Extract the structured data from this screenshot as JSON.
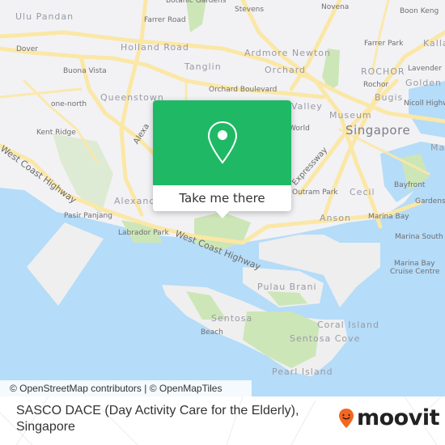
{
  "map": {
    "labels": {
      "ulu_pandan": "Ulu Pandan",
      "botanic_gardens": "Botanic Gardens",
      "farrer_road": "Farrer Road",
      "stevens": "Stevens",
      "novena": "Novena",
      "boon_keng": "Boon Keng",
      "dover": "Dover",
      "holland_road": "Holland Road",
      "ardmore": "Ardmore",
      "newton": "Newton",
      "farrer_park": "Farrer Park",
      "kallang": "Kalla",
      "tanglin": "Tanglin",
      "orchard": "Orchard",
      "rochor_area": "ROCHOR",
      "lavender": "Lavender",
      "buona_vista": "Buona Vista",
      "orchard_boulevard": "Orchard Boulevard",
      "rochor": "Rochor",
      "golden_mile": "Golden M",
      "queenstown": "Queenstown",
      "bugis": "Bugis",
      "valley": "Valley",
      "nicoll_highway": "Nicoll Highw",
      "one_north": "one-north",
      "museum": "Museum",
      "world": "World",
      "kent_ridge": "Kent Ridge",
      "singapore": "Singapore",
      "marina_area": "Mar",
      "alexandra_road": "Alexa",
      "expressway": "Expressway",
      "west_coast_highway_1": "West Coast Highway",
      "bayfront": "Bayfront",
      "alexandra": "Alexandr",
      "outram_park": "Outram Park",
      "cecil": "Cecil",
      "gardens": "Gardens",
      "pasir_panjang": "Pasir Panjang",
      "anson": "Anson",
      "marina_bay": "Marina Bay",
      "labrador_park": "Labrador Park",
      "west_coast_highway_2": "West Coast Highway",
      "marina_south_pier": "Marina South Pi",
      "marina_bay_cruise_1": "Marina Bay",
      "marina_bay_cruise_2": "Cruise Centre",
      "pulau_brani": "Pulau Brani",
      "sentosa": "Sentosa",
      "beach": "Beach",
      "coral_island": "Coral Island",
      "sentosa_cove": "Sentosa Cove",
      "pearl_island": "Pearl Island"
    },
    "colors": {
      "land": "#f2f2f4",
      "water": "#b5dcf8",
      "park": "#cde6b8",
      "road": "#fbe7a6",
      "accent": "#1fb966",
      "brand": "#f26722"
    }
  },
  "popup": {
    "icon": "map-pin-icon",
    "button_label": "Take me there"
  },
  "attribution": "© OpenStreetMap contributors | © OpenMapTiles",
  "footer": {
    "place_title": "SASCO DACE (Day Activity Care for the Elderly), Singapore",
    "logo_text": "moovit"
  }
}
